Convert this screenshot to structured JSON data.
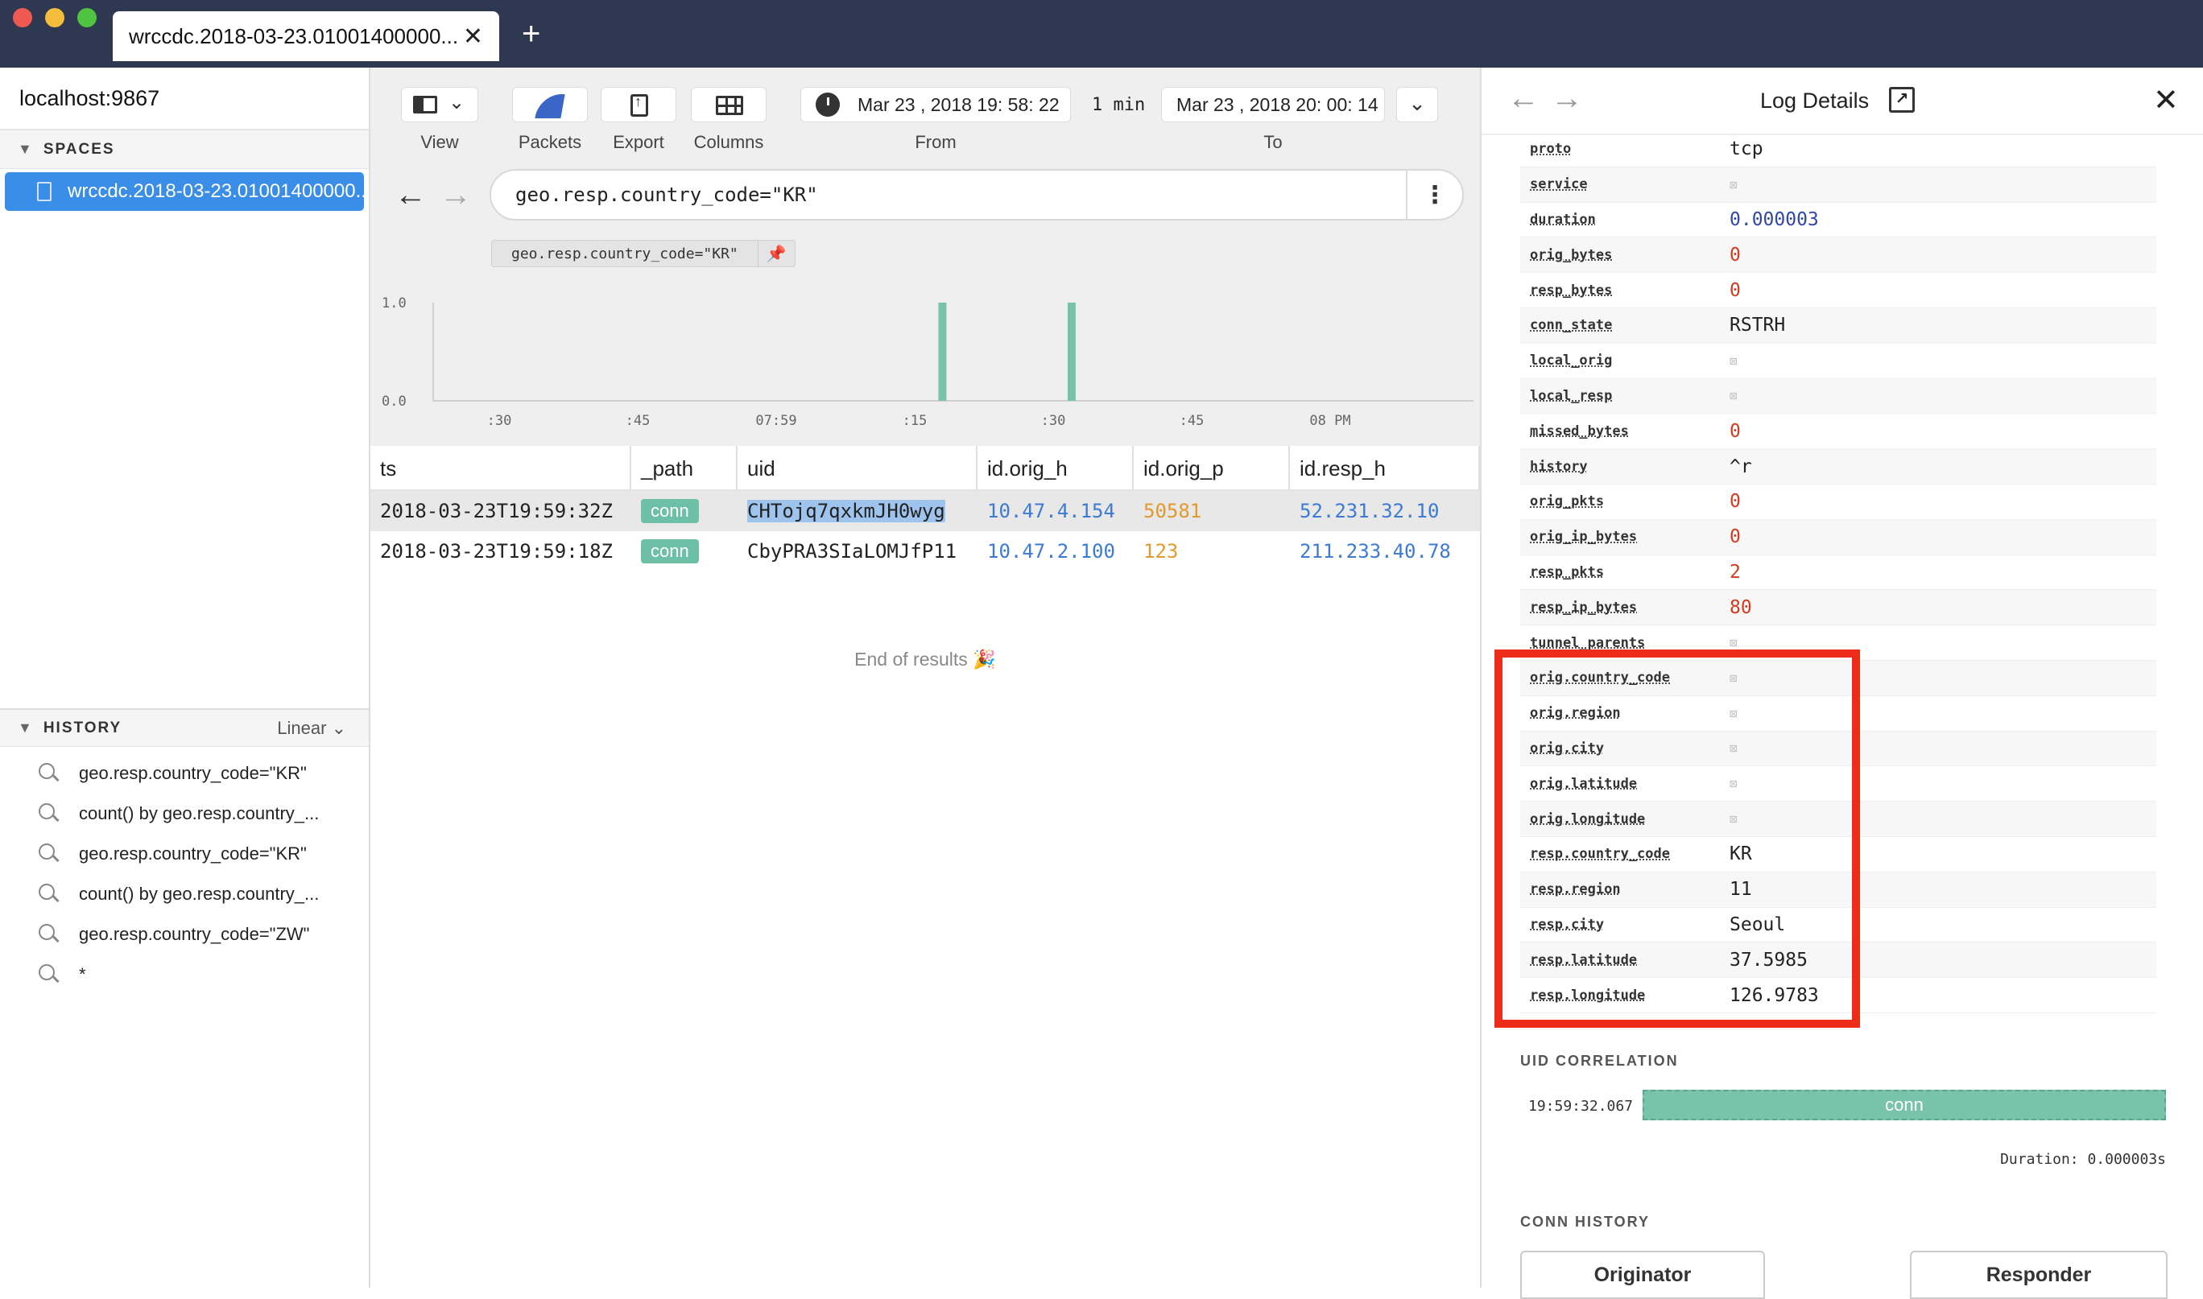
{
  "window": {
    "tab_title": "wrccdc.2018-03-23.01001400000...",
    "tab_close": "✕",
    "new_tab": "+"
  },
  "sidebar": {
    "host": "localhost:9867",
    "spaces_label": "SPACES",
    "space_item": "wrccdc.2018-03-23.01001400000...",
    "history_label": "HISTORY",
    "history_mode": "Linear",
    "history_items": [
      "geo.resp.country_code=\"KR\"",
      "count() by geo.resp.country_...",
      "geo.resp.country_code=\"KR\"",
      "count() by geo.resp.country_...",
      "geo.resp.country_code=\"ZW\"",
      "*"
    ]
  },
  "toolbar": {
    "view": "View",
    "packets": "Packets",
    "export": "Export",
    "columns": "Columns",
    "from_value": "Mar  23 , 2018  19: 58: 22",
    "duration": "1  min",
    "to_value": "Mar  23 , 2018  20: 00: 14",
    "from_label": "From",
    "to_label": "To"
  },
  "search": {
    "query": "geo.resp.country_code=\"KR\"",
    "pill": "geo.resp.country_code=\"KR\"",
    "menu": "⋮"
  },
  "chart_data": {
    "type": "bar",
    "title": "",
    "xlabel": "",
    "ylabel": "",
    "y_ticks": [
      "1.0",
      "0.0"
    ],
    "ylim": [
      0,
      1
    ],
    "x_ticks": [
      ":30",
      ":45",
      "07:59",
      ":15",
      ":30",
      ":45",
      "08 PM"
    ],
    "bars": [
      {
        "x": "19:59:18",
        "value": 1
      },
      {
        "x": "19:59:32",
        "value": 1
      }
    ],
    "color": "#7ac3ab"
  },
  "table": {
    "columns": [
      "ts",
      "_path",
      "uid",
      "id.orig_h",
      "id.orig_p",
      "id.resp_h"
    ],
    "rows": [
      {
        "ts": "2018-03-23T19:59:32Z",
        "path": "conn",
        "uid": "CHTojq7qxkmJH0wyg",
        "orig_h": "10.47.4.154",
        "orig_p": "50581",
        "resp_h": "52.231.32.10"
      },
      {
        "ts": "2018-03-23T19:59:18Z",
        "path": "conn",
        "uid": "CbyPRA3SIaLOMJfP11",
        "orig_h": "10.47.2.100",
        "orig_p": "123",
        "resp_h": "211.233.40.78"
      }
    ],
    "end_text": "End of results 🎉"
  },
  "panel": {
    "title": "Log Details",
    "fields": [
      {
        "name": "proto",
        "value": "tcp",
        "kind": "text"
      },
      {
        "name": "service",
        "value": "⊠",
        "kind": "null"
      },
      {
        "name": "duration",
        "value": "0.000003",
        "kind": "dur"
      },
      {
        "name": "orig_bytes",
        "value": "0",
        "kind": "num"
      },
      {
        "name": "resp_bytes",
        "value": "0",
        "kind": "num"
      },
      {
        "name": "conn_state",
        "value": "RSTRH",
        "kind": "text"
      },
      {
        "name": "local_orig",
        "value": "⊠",
        "kind": "null"
      },
      {
        "name": "local_resp",
        "value": "⊠",
        "kind": "null"
      },
      {
        "name": "missed_bytes",
        "value": "0",
        "kind": "num"
      },
      {
        "name": "history",
        "value": "^r",
        "kind": "text"
      },
      {
        "name": "orig_pkts",
        "value": "0",
        "kind": "num"
      },
      {
        "name": "orig_ip_bytes",
        "value": "0",
        "kind": "num"
      },
      {
        "name": "resp_pkts",
        "value": "2",
        "kind": "num"
      },
      {
        "name": "resp_ip_bytes",
        "value": "80",
        "kind": "num"
      },
      {
        "name": "tunnel_parents",
        "value": "⊠",
        "kind": "null"
      },
      {
        "name": "orig.country_code",
        "value": "⊠",
        "kind": "null"
      },
      {
        "name": "orig.region",
        "value": "⊠",
        "kind": "null"
      },
      {
        "name": "orig.city",
        "value": "⊠",
        "kind": "null"
      },
      {
        "name": "orig.latitude",
        "value": "⊠",
        "kind": "null"
      },
      {
        "name": "orig.longitude",
        "value": "⊠",
        "kind": "null"
      },
      {
        "name": "resp.country_code",
        "value": "KR",
        "kind": "text"
      },
      {
        "name": "resp.region",
        "value": "11",
        "kind": "text"
      },
      {
        "name": "resp.city",
        "value": "Seoul",
        "kind": "text"
      },
      {
        "name": "resp.latitude",
        "value": "37.5985",
        "kind": "text"
      },
      {
        "name": "resp.longitude",
        "value": "126.9783",
        "kind": "text"
      }
    ],
    "highlight_color": "#ee2c1a",
    "uid_correlation_label": "UID CORRELATION",
    "uid_time": "19:59:32.067",
    "uid_bar_label": "conn",
    "uid_duration": "Duration: 0.000003s",
    "conn_history_label": "CONN HISTORY",
    "originator": "Originator",
    "responder": "Responder"
  }
}
